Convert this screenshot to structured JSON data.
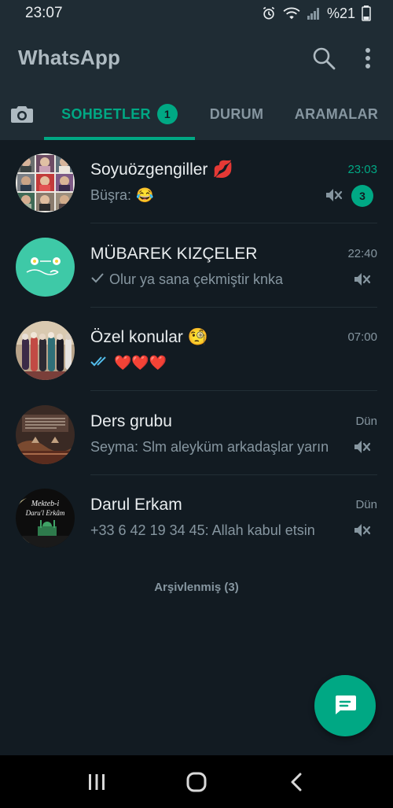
{
  "status_bar": {
    "time": "23:07",
    "battery": "%21"
  },
  "app": {
    "title": "WhatsApp"
  },
  "tabs": [
    {
      "label": "SOHBETLER",
      "badge": "1"
    },
    {
      "label": "DURUM"
    },
    {
      "label": "ARAMALAR"
    }
  ],
  "chats": [
    {
      "name": "Soyuözgengiller",
      "name_emoji": "💋",
      "sender": "Büşra:",
      "message": "😂",
      "time": "23:03",
      "unread": "3"
    },
    {
      "name": "MÜBAREK KIZÇELER",
      "message": "Olur ya sana çekmiştir knka",
      "time": "22:40"
    },
    {
      "name": "Özel konular",
      "name_emoji": "🧐",
      "message": "❤️❤️❤️",
      "time": "07:00"
    },
    {
      "name": "Ders grubu",
      "message": "Seyma: Slm aleyküm arkadaşlar yarın",
      "time": "Dün"
    },
    {
      "name": "Darul Erkam",
      "message": "+33 6 42 19 34 45: Allah kabul etsin",
      "time": "Dün",
      "avatar_text_top": "Mekteb-i",
      "avatar_text_bottom": "Daru'l Erkâm"
    }
  ],
  "archived_label": "Arşivlenmiş (3)",
  "colors": {
    "accent": "#00a884",
    "background": "#121b22",
    "header": "#1f2c34"
  }
}
